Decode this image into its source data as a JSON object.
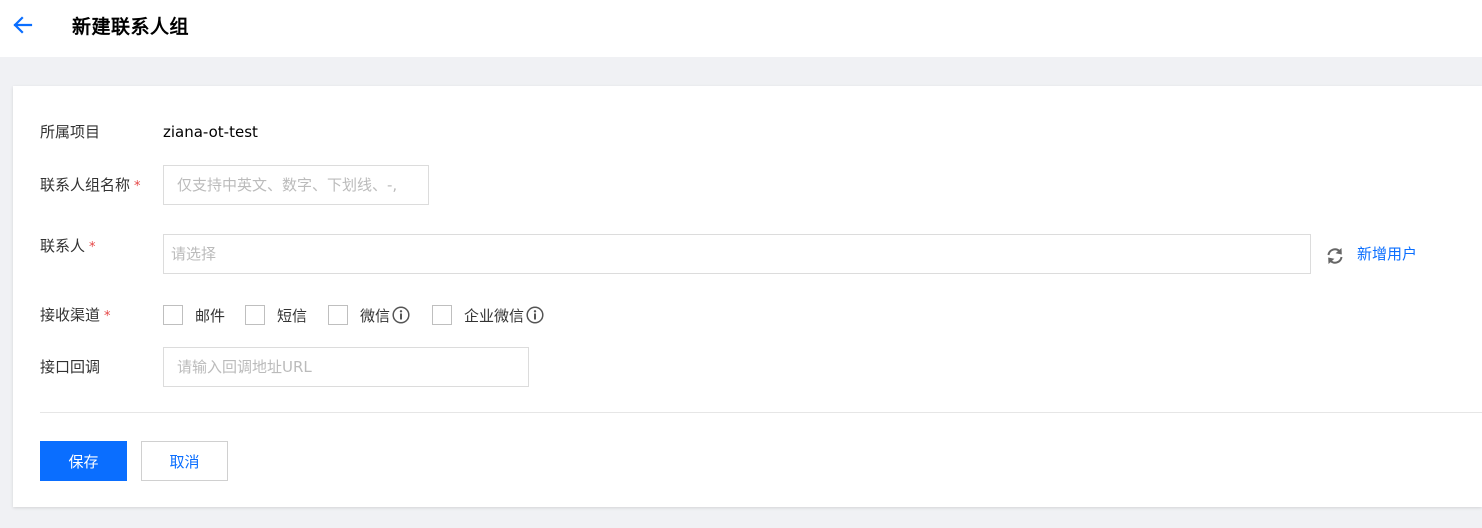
{
  "header": {
    "title": "新建联系人组"
  },
  "form": {
    "project": {
      "label": "所属项目",
      "value": "ziana-ot-test"
    },
    "group_name": {
      "label": "联系人组名称",
      "required_mark": "*",
      "placeholder": "仅支持中英文、数字、下划线、-,"
    },
    "contacts": {
      "label": "联系人",
      "required_mark": "*",
      "placeholder": "请选择",
      "add_link": "新增用户"
    },
    "channels": {
      "label": "接收渠道",
      "required_mark": "*",
      "options": [
        {
          "label": "邮件",
          "checked": false
        },
        {
          "label": "短信",
          "checked": false
        },
        {
          "label": "微信",
          "checked": false,
          "info_icon": true
        },
        {
          "label": "企业微信",
          "checked": false,
          "info_icon": true
        }
      ]
    },
    "callback": {
      "label": "接口回调",
      "placeholder": "请输入回调地址URL"
    }
  },
  "actions": {
    "save_label": "保存",
    "cancel_label": "取消"
  },
  "colors": {
    "accent": "#0a6eff",
    "required": "#e54545",
    "page_bg": "#f0f1f4"
  },
  "icons": {
    "back": "arrow-left-icon",
    "refresh": "refresh-icon",
    "info": "info-icon"
  }
}
